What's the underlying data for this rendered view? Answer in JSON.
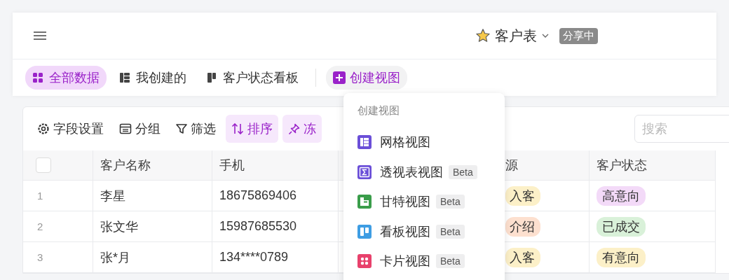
{
  "header": {
    "title": "客户表",
    "badge": "分享中"
  },
  "tabs": [
    {
      "label": "全部数据",
      "kind": "grid",
      "selected": true
    },
    {
      "label": "我创建的",
      "kind": "list",
      "selected": false
    },
    {
      "label": "客户状态看板",
      "kind": "kanban",
      "selected": false
    }
  ],
  "create_view_button": "创建视图",
  "toolbar": {
    "buttons": [
      {
        "label": "字段设置",
        "kind": "gear",
        "active": false
      },
      {
        "label": "分组",
        "kind": "group",
        "active": false
      },
      {
        "label": "筛选",
        "kind": "filter",
        "active": false
      },
      {
        "label": "排序",
        "kind": "sort",
        "active": true
      },
      {
        "label": "冻",
        "kind": "pin",
        "active": true
      }
    ],
    "search": {
      "placeholder": "搜索"
    }
  },
  "table": {
    "select_all_checked": false,
    "columns": [
      "客户名称",
      "手机",
      "源",
      "客户状态"
    ],
    "rows": [
      {
        "number": "1",
        "name": "李星",
        "phone": "18675869406",
        "source": {
          "text": "入客",
          "color": "#fcf0c8"
        },
        "status": {
          "text": "高意向",
          "color": "#f3daf8"
        }
      },
      {
        "number": "2",
        "name": "张文华",
        "phone": "15987685530",
        "source": {
          "text": "介绍",
          "color": "#fde0cf"
        },
        "status": {
          "text": "已成交",
          "color": "#d9f1d9"
        }
      },
      {
        "number": "3",
        "name": "张*月",
        "phone": "134****0789",
        "source": {
          "text": "入客",
          "color": "#fcf0c8"
        },
        "status": {
          "text": "有意向",
          "color": "#fcf0c8"
        }
      }
    ]
  },
  "create_menu": {
    "title": "创建视图",
    "items": [
      {
        "label": "网格视图",
        "kind": "grid",
        "color": "#6b4fd8"
      },
      {
        "label": "透视表视图",
        "kind": "pivot",
        "color": "#6b4fd8",
        "badge": "Beta"
      },
      {
        "label": "甘特视图",
        "kind": "gantt",
        "color": "#3a9d4a",
        "badge": "Beta"
      },
      {
        "label": "看板视图",
        "kind": "kanban",
        "color": "#3e9de3",
        "badge": "Beta"
      },
      {
        "label": "卡片视图",
        "kind": "card",
        "color": "#e8416c",
        "badge": "Beta"
      }
    ]
  }
}
